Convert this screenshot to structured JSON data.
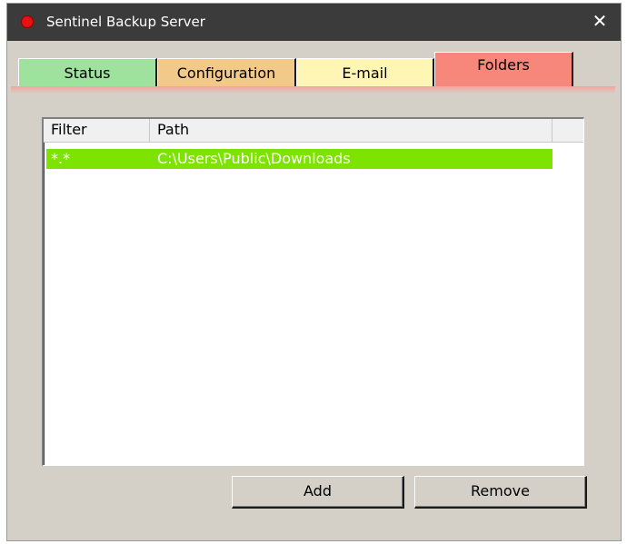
{
  "window": {
    "title": "Sentinel Backup Server",
    "close_glyph": "✕",
    "title_icon": "red-circle-icon"
  },
  "tabs": [
    {
      "label": "Status",
      "color": "#9ee29e"
    },
    {
      "label": "Configuration",
      "color": "#f3c98a"
    },
    {
      "label": "E-mail",
      "color": "#fff5b5"
    },
    {
      "label": "Folders",
      "color": "#f7877a",
      "active": true
    }
  ],
  "folders": {
    "columns": [
      "Filter",
      "Path"
    ],
    "rows": [
      {
        "filter": "*.*",
        "path": "C:\\Users\\Public\\Downloads",
        "selected": true
      }
    ],
    "selection_color": "#7ce400"
  },
  "buttons": {
    "add_label": "Add",
    "remove_label": "Remove"
  }
}
